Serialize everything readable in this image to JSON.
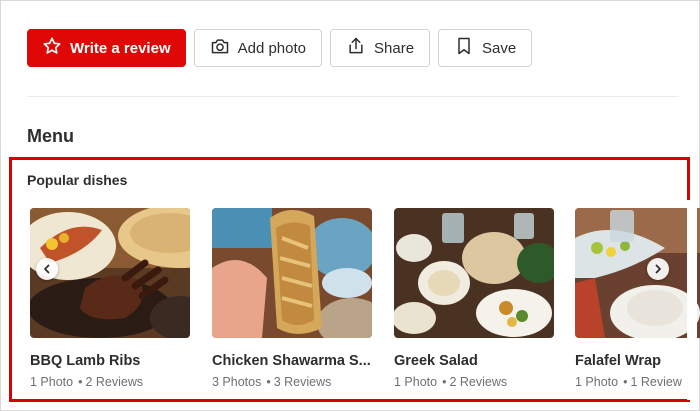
{
  "actions": {
    "write_review": "Write a review",
    "add_photo": "Add photo",
    "share": "Share",
    "save": "Save"
  },
  "menu": {
    "title": "Menu",
    "popular_title": "Popular dishes",
    "dishes": [
      {
        "name": "BBQ Lamb Ribs",
        "photos": "1 Photo",
        "reviews": "2 Reviews"
      },
      {
        "name": "Chicken Shawarma S...",
        "photos": "3 Photos",
        "reviews": "3 Reviews"
      },
      {
        "name": "Greek Salad",
        "photos": "1 Photo",
        "reviews": "2 Reviews"
      },
      {
        "name": "Falafel Wrap",
        "photos": "1 Photo",
        "reviews": "1 Review"
      }
    ]
  },
  "icons": {
    "write_review": "star-icon",
    "add_photo": "camera-icon",
    "share": "share-icon",
    "save": "bookmark-icon",
    "prev": "chevron-left-icon",
    "next": "chevron-right-icon"
  },
  "colors": {
    "brand_red": "#e00707",
    "highlight_border": "#d90000",
    "text": "#2d2e2f",
    "muted": "#6e7072"
  }
}
